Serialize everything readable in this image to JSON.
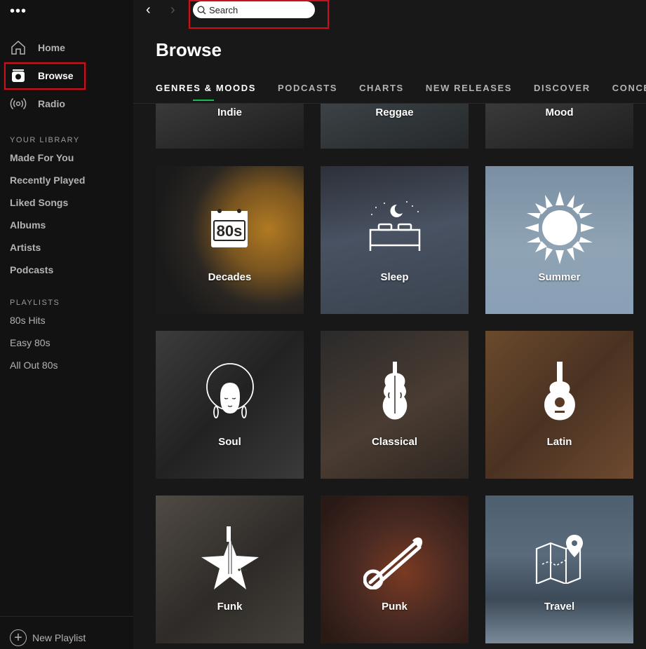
{
  "app": {
    "menu_dots": "•••"
  },
  "sidebar": {
    "nav": [
      {
        "label": "Home",
        "icon": "home-icon"
      },
      {
        "label": "Browse",
        "icon": "browse-icon"
      },
      {
        "label": "Radio",
        "icon": "radio-icon"
      }
    ],
    "library_title": "YOUR LIBRARY",
    "library": [
      "Made For You",
      "Recently Played",
      "Liked Songs",
      "Albums",
      "Artists",
      "Podcasts"
    ],
    "playlists_title": "PLAYLISTS",
    "playlists": [
      "80s Hits",
      "Easy 80s",
      "All Out 80s"
    ],
    "new_playlist": "New Playlist"
  },
  "topbar": {
    "back": "‹",
    "forward": "›",
    "search_placeholder": "Search"
  },
  "main": {
    "title": "Browse",
    "tabs": [
      "GENRES & MOODS",
      "PODCASTS",
      "CHARTS",
      "NEW RELEASES",
      "DISCOVER",
      "CONCERTS"
    ],
    "tiles": [
      {
        "label": "Indie",
        "icon": "none",
        "bg": "#2a2a2a"
      },
      {
        "label": "Reggae",
        "icon": "none",
        "bg": "#2e3234"
      },
      {
        "label": "Mood",
        "icon": "none",
        "bg": "#2b2b2b"
      },
      {
        "label": "Decades",
        "icon": "calendar-80s-icon",
        "bg": "#2c2a24"
      },
      {
        "label": "Sleep",
        "icon": "bed-moon-icon",
        "bg": "#3a4048"
      },
      {
        "label": "Summer",
        "icon": "sun-icon",
        "bg": "#6f8496"
      },
      {
        "label": "Soul",
        "icon": "afro-woman-icon",
        "bg": "#2d2d2d"
      },
      {
        "label": "Classical",
        "icon": "violin-icon",
        "bg": "#3a2f28"
      },
      {
        "label": "Latin",
        "icon": "guitar-icon",
        "bg": "#5a3a24"
      },
      {
        "label": "Funk",
        "icon": "star-guitar-icon",
        "bg": "#3a3632"
      },
      {
        "label": "Punk",
        "icon": "safety-pin-icon",
        "bg": "#4a2a22"
      },
      {
        "label": "Travel",
        "icon": "map-pin-icon",
        "bg": "#556677"
      }
    ]
  },
  "colors": {
    "accent": "#1db954",
    "highlight": "#c8101e"
  }
}
